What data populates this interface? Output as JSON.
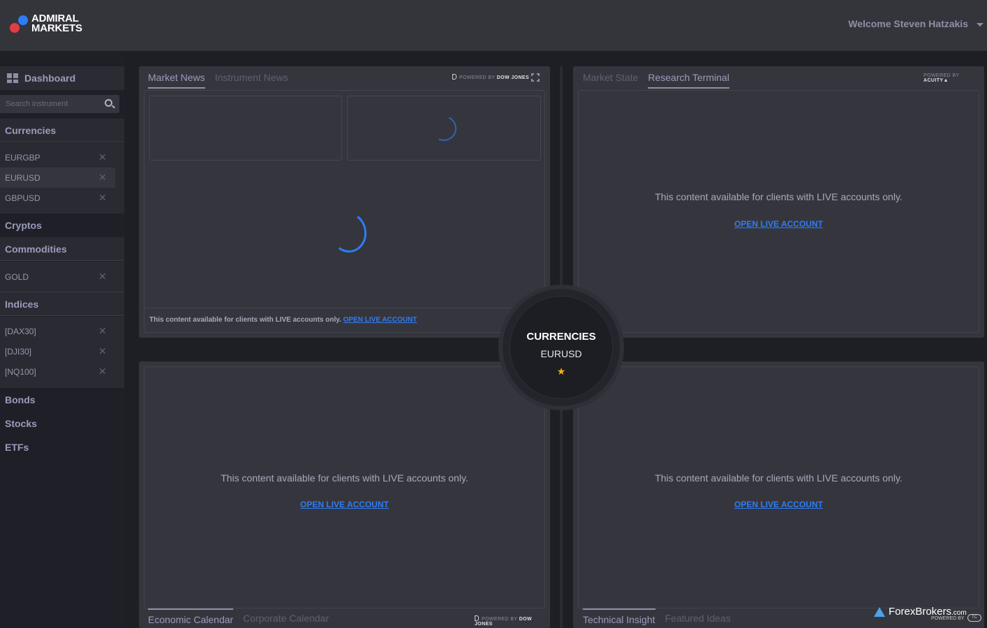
{
  "header": {
    "logo_line1": "ADMIRAL",
    "logo_line2": "MARKETS",
    "welcome": "Welcome Steven Hatzakis",
    "brand_colors": {
      "blue": "#2e7cf6",
      "red": "#e23d45"
    }
  },
  "sidebar": {
    "dashboard_label": "Dashboard",
    "search_placeholder": "Search instrument",
    "categories": [
      {
        "label": "Currencies",
        "items": [
          "EURGBP",
          "EURUSD",
          "GBPUSD"
        ],
        "active_item": "EURUSD"
      },
      {
        "label": "Cryptos",
        "items": []
      },
      {
        "label": "Commodities",
        "items": [
          "GOLD"
        ]
      },
      {
        "label": "Indices",
        "items": [
          "[DAX30]",
          "[DJI30]",
          "[NQ100]"
        ]
      },
      {
        "label": "Bonds",
        "items": []
      },
      {
        "label": "Stocks",
        "items": []
      },
      {
        "label": "ETFs",
        "items": []
      }
    ]
  },
  "panels": {
    "top_left": {
      "tabs": [
        "Market News",
        "Instrument News"
      ],
      "active_tab": "Market News",
      "powered_prefix": "POWERED BY",
      "powered_brand": "DOW JONES",
      "locked_message": "This content available for clients with LIVE accounts only.",
      "link": "OPEN LIVE ACCOUNT"
    },
    "top_right": {
      "tabs": [
        "Market State",
        "Research Terminal"
      ],
      "active_tab": "Research Terminal",
      "powered_prefix": "POWERED BY",
      "powered_brand": "ACUITY",
      "locked_message": "This content available for clients with LIVE accounts only.",
      "link": "OPEN LIVE ACCOUNT"
    },
    "bottom_left": {
      "tabs": [
        "Economic Calendar",
        "Corporate Calendar"
      ],
      "active_tab": "Economic Calendar",
      "powered_prefix": "POWERED BY",
      "powered_brand": "DOW JONES",
      "locked_message": "This content available for clients with LIVE accounts only.",
      "link": "OPEN LIVE ACCOUNT"
    },
    "bottom_right": {
      "tabs": [
        "Technical Insight",
        "Featured Ideas"
      ],
      "active_tab": "Technical Insight",
      "locked_message": "This content available for clients with LIVE accounts only.",
      "link": "OPEN LIVE ACCOUNT"
    }
  },
  "hub": {
    "category": "CURRENCIES",
    "instrument": "EURUSD",
    "favorite_icon": "star"
  },
  "watermark": {
    "name": "ForexBrokers",
    "suffix": ".com",
    "powered": "POWERED BY",
    "badge": "TC"
  }
}
